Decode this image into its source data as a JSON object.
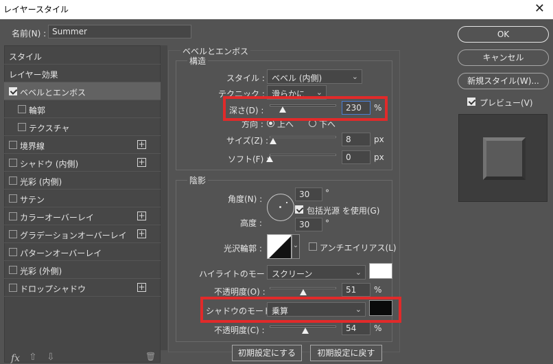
{
  "window": {
    "title": "レイヤースタイル",
    "close_glyph": "✕"
  },
  "name_field": {
    "label": "名前(N) :",
    "value": "Summer"
  },
  "left_panel": {
    "items": [
      {
        "label": "スタイル",
        "checkbox": false,
        "checked": false,
        "plus": false,
        "selected": false,
        "indent": false
      },
      {
        "label": "レイヤー効果",
        "checkbox": false,
        "checked": false,
        "plus": false,
        "selected": false,
        "indent": false
      },
      {
        "label": "ベベルとエンボス",
        "checkbox": true,
        "checked": true,
        "plus": false,
        "selected": true,
        "indent": false
      },
      {
        "label": "輪郭",
        "checkbox": true,
        "checked": false,
        "plus": false,
        "selected": false,
        "indent": true
      },
      {
        "label": "テクスチャ",
        "checkbox": true,
        "checked": false,
        "plus": false,
        "selected": false,
        "indent": true
      },
      {
        "label": "境界線",
        "checkbox": true,
        "checked": false,
        "plus": true,
        "selected": false,
        "indent": false
      },
      {
        "label": "シャドウ (内側)",
        "checkbox": true,
        "checked": false,
        "plus": true,
        "selected": false,
        "indent": false
      },
      {
        "label": "光彩 (内側)",
        "checkbox": true,
        "checked": false,
        "plus": false,
        "selected": false,
        "indent": false
      },
      {
        "label": "サテン",
        "checkbox": true,
        "checked": false,
        "plus": false,
        "selected": false,
        "indent": false
      },
      {
        "label": "カラーオーバーレイ",
        "checkbox": true,
        "checked": false,
        "plus": true,
        "selected": false,
        "indent": false
      },
      {
        "label": "グラデーションオーバーレイ",
        "checkbox": true,
        "checked": false,
        "plus": true,
        "selected": false,
        "indent": false
      },
      {
        "label": "パターンオーバーレイ",
        "checkbox": true,
        "checked": false,
        "plus": false,
        "selected": false,
        "indent": false
      },
      {
        "label": "光彩 (外側)",
        "checkbox": true,
        "checked": false,
        "plus": false,
        "selected": false,
        "indent": false
      },
      {
        "label": "ドロップシャドウ",
        "checkbox": true,
        "checked": false,
        "plus": true,
        "selected": false,
        "indent": false
      }
    ],
    "plus_glyph": "+",
    "bottom_icons": {
      "fx": "fx",
      "up": "⇧",
      "down": "⇩",
      "trash": "🗑"
    }
  },
  "bevel": {
    "section_title": "ベベルとエンボス",
    "structure_title": "構造",
    "style_label": "スタイル :",
    "style_value": "ベベル (内側)",
    "technique_label": "テクニック :",
    "technique_value": "滑らかに",
    "depth_label": "深さ(D) :",
    "depth_value": "230",
    "depth_unit": "%",
    "depth_level": 0.2,
    "direction_label": "方向 :",
    "direction_up": "上へ",
    "direction_down": "下へ",
    "direction_selected": "up",
    "size_label": "サイズ(Z) :",
    "size_value": "8",
    "size_unit": "px",
    "size_level": 0.05,
    "soften_label": "ソフト(F) :",
    "soften_value": "0",
    "soften_unit": "px",
    "soften_level": 0.0
  },
  "shading": {
    "title": "陰影",
    "angle_label": "角度(N) :",
    "angle_value": "30",
    "angle_unit": "°",
    "global_light_label": "包括光源 を使用(G)",
    "global_light_checked": true,
    "altitude_label": "高度 :",
    "altitude_value": "30",
    "altitude_unit": "°",
    "gloss_contour_label": "光沢輪郭 :",
    "anti_alias_label": "アンチエイリアス(L)",
    "anti_alias_checked": false,
    "highlight_mode_label": "ハイライトのモード :",
    "highlight_mode_value": "スクリーン",
    "highlight_color": "#ffffff",
    "highlight_opacity_label": "不透明度(O) :",
    "highlight_opacity_value": "51",
    "highlight_opacity_level": 0.51,
    "shadow_mode_label": "シャドウのモード :",
    "shadow_mode_value": "乗算",
    "shadow_color": "#0a0a0a",
    "shadow_opacity_label": "不透明度(C) :",
    "shadow_opacity_value": "54",
    "shadow_opacity_level": 0.54,
    "percent": "%"
  },
  "buttons": {
    "ok": "OK",
    "cancel": "キャンセル",
    "new_style": "新規スタイル(W)...",
    "preview_label": "プレビュー(V)",
    "preview_checked": true,
    "set_default": "初期設定にする",
    "reset_default": "初期設定に戻す"
  },
  "colors": {
    "highlight_box": "#e12a2a",
    "panel_bg": "#535353"
  }
}
